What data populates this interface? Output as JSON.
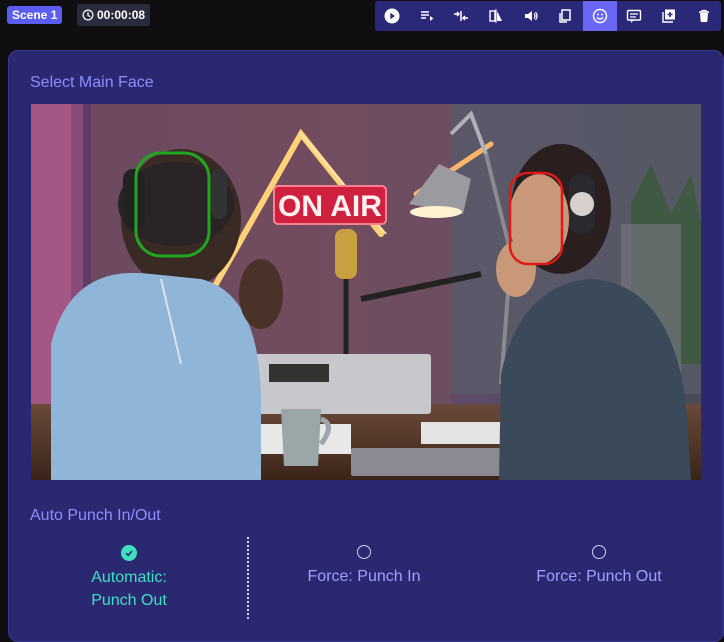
{
  "header": {
    "scene_label": "Scene 1",
    "timer": "00:00:08"
  },
  "toolbar": {
    "buttons": [
      {
        "icon": "play-icon"
      },
      {
        "icon": "playlist-icon"
      },
      {
        "icon": "merge-icon"
      },
      {
        "icon": "flip-icon"
      },
      {
        "icon": "volume-icon"
      },
      {
        "icon": "copy-icon"
      },
      {
        "icon": "face-icon",
        "active": true
      },
      {
        "icon": "caption-icon"
      },
      {
        "icon": "add-icon"
      },
      {
        "icon": "trash-icon"
      }
    ]
  },
  "main": {
    "select_face_title": "Select Main Face",
    "photo_sign": "ON AIR",
    "punch_title": "Auto Punch In/Out",
    "options": [
      {
        "line1": "Automatic:",
        "line2": "Punch Out",
        "selected": true
      },
      {
        "line1": "Force: Punch In",
        "line2": "",
        "selected": false
      },
      {
        "line1": "Force: Punch Out",
        "line2": "",
        "selected": false
      }
    ]
  },
  "colors": {
    "accent": "#5b5cf0",
    "panel": "#2b2872",
    "selected": "#3fe0c0",
    "face_selected": "#1fa81f",
    "face_unselected": "#e01818"
  }
}
